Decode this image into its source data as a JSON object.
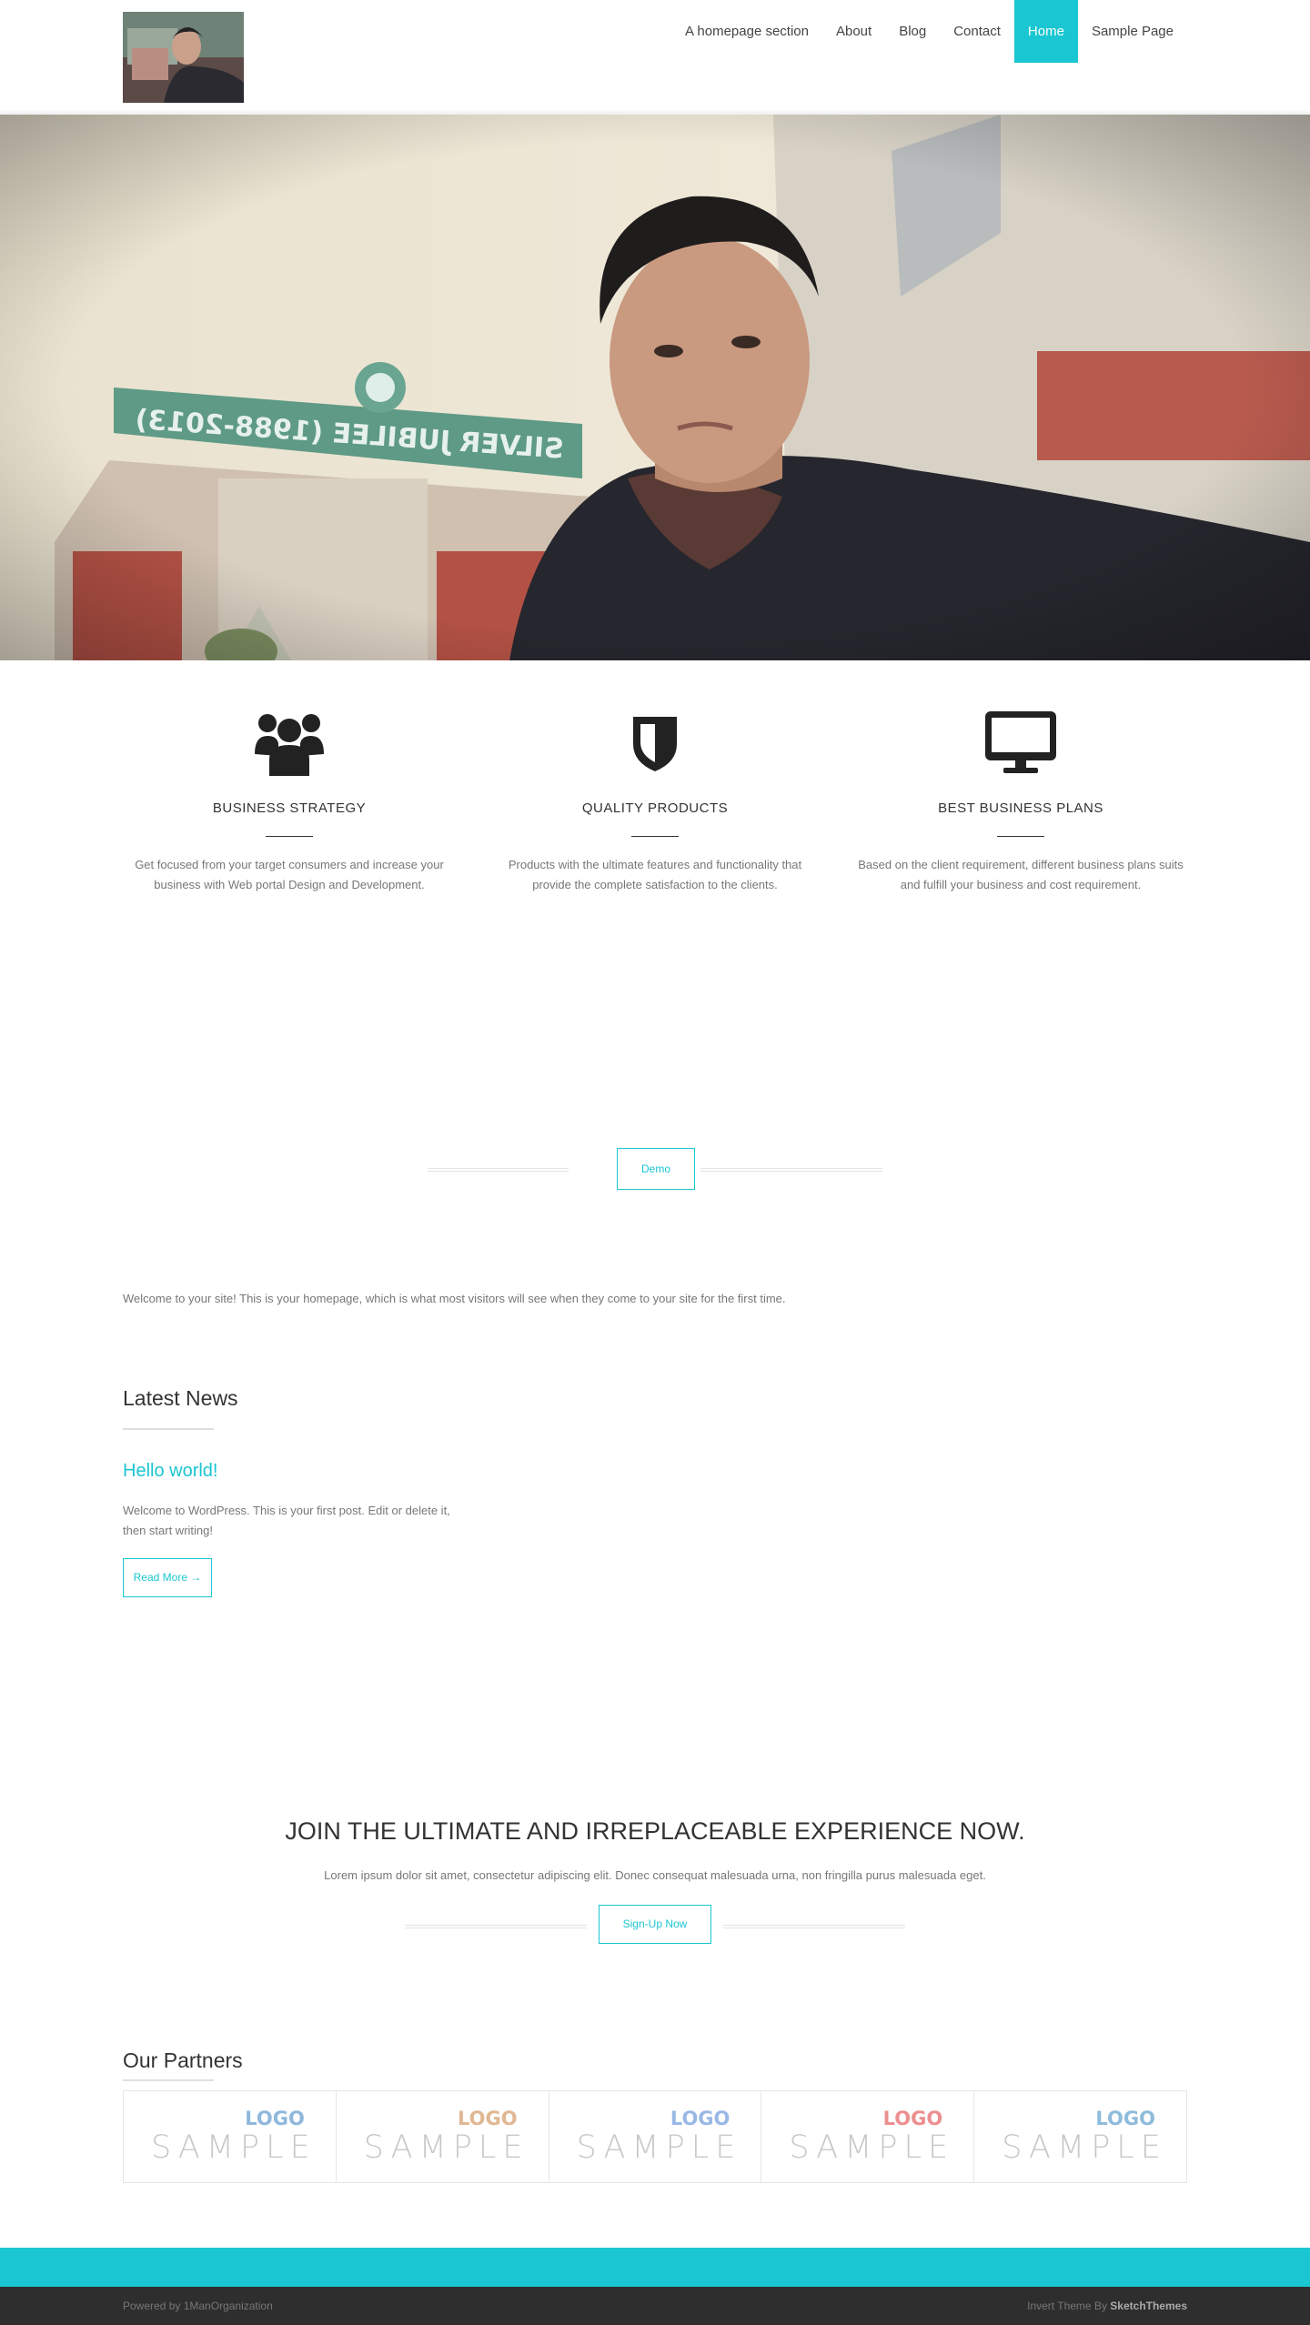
{
  "colors": {
    "accent": "#1ac6d1",
    "footer_dark": "#2e2e2e"
  },
  "nav": {
    "items": [
      {
        "label": "A homepage section"
      },
      {
        "label": "About"
      },
      {
        "label": "Blog"
      },
      {
        "label": "Contact"
      },
      {
        "label": "Home",
        "active": true
      },
      {
        "label": "Sample Page"
      }
    ]
  },
  "features": [
    {
      "icon": "users-icon",
      "title": "BUSINESS STRATEGY",
      "text": "Get focused from your target consumers and increase your business with Web portal Design and Development."
    },
    {
      "icon": "shield-icon",
      "title": "QUALITY PRODUCTS",
      "text": "Products with the ultimate features and functionality that provide the complete satisfaction to the clients."
    },
    {
      "icon": "desktop-icon",
      "title": "BEST BUSINESS PLANS",
      "text": "Based on the client requirement, different business plans suits and fulfill your business and cost requirement."
    }
  ],
  "demo": {
    "label": "Demo"
  },
  "welcome": "Welcome to your site! This is your homepage, which is what most visitors will see when they come to your site for the first time.",
  "news": {
    "title": "Latest News",
    "post": {
      "title": "Hello world!",
      "excerpt": "Welcome to WordPress. This is your first post. Edit or delete it, then start writing!",
      "read_more": "Read More →"
    }
  },
  "cta": {
    "title": "JOIN THE ULTIMATE AND IRREPLACEABLE EXPERIENCE NOW.",
    "text": "Lorem ipsum dolor sit amet, consectetur adipiscing elit. Donec consequat malesuada urna, non fringilla purus malesuada eget.",
    "button": "Sign-Up Now"
  },
  "partners": {
    "title": "Our Partners",
    "items": [
      {
        "logo": "LOGO",
        "sample": "SAMPLE",
        "color": "#8fb8dc"
      },
      {
        "logo": "LOGO",
        "sample": "SAMPLE",
        "color": "#e0b894"
      },
      {
        "logo": "LOGO",
        "sample": "SAMPLE",
        "color": "#9ab8e6"
      },
      {
        "logo": "LOGO",
        "sample": "SAMPLE",
        "color": "#ec8f8f"
      },
      {
        "logo": "LOGO",
        "sample": "SAMPLE",
        "color": "#8fbcdc"
      }
    ]
  },
  "footer": {
    "left": "Powered by 1ManOrganization",
    "right_prefix": "Invert Theme By",
    "right_brand": "SketchThemes"
  }
}
